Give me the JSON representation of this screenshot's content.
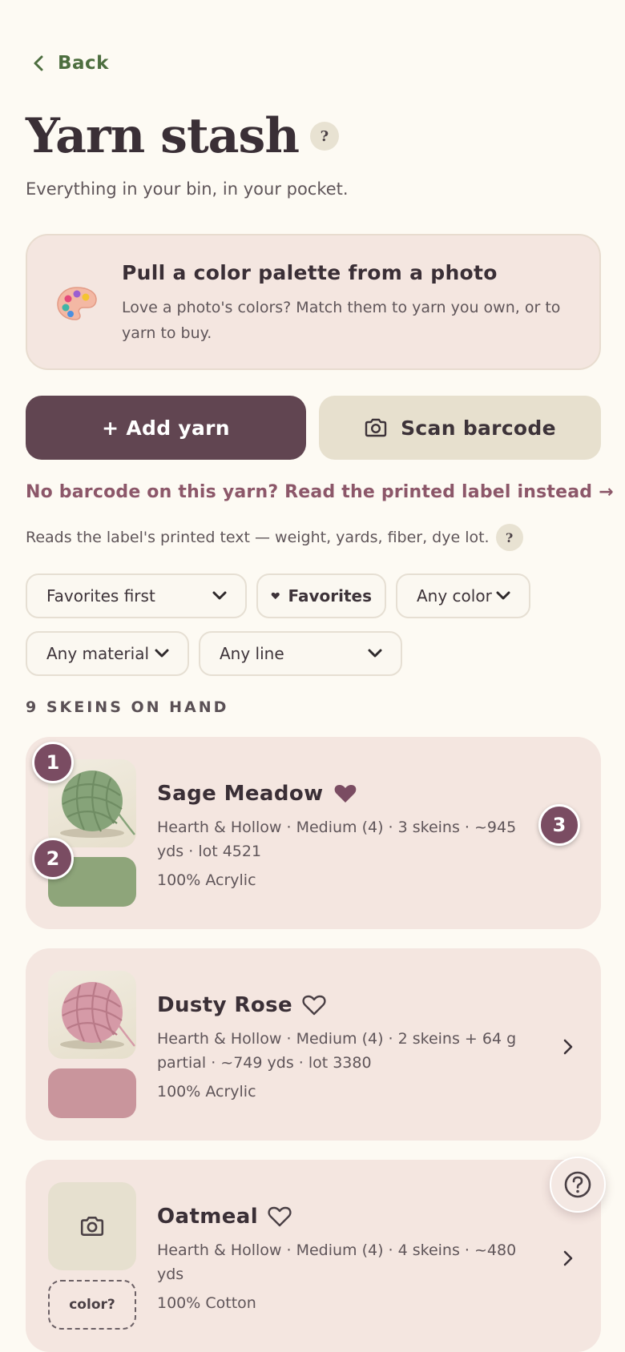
{
  "nav": {
    "back_label": "Back"
  },
  "header": {
    "title": "Yarn stash",
    "help_glyph": "?",
    "subtitle": "Everything in your bin, in your pocket."
  },
  "palette_card": {
    "icon": "palette-icon",
    "title": "Pull a color palette from a photo",
    "description": "Love a photo's colors? Match them to yarn you own, or to yarn to buy."
  },
  "actions": {
    "add_label": "+ Add yarn",
    "scan_label": "Scan barcode",
    "scan_icon": "camera-icon",
    "label_link": "No barcode on this yarn? Read the printed label instead →",
    "label_note": "Reads the label's printed text — weight, yards, fiber, dye lot.",
    "label_help_glyph": "?"
  },
  "filters": {
    "sort": "Favorites first",
    "favorites": "Favorites",
    "color": "Any color",
    "material": "Any material",
    "line": "Any line"
  },
  "stash": {
    "count_label": "9 SKEINS ON HAND",
    "items": [
      {
        "name": "Sage Meadow",
        "favorite": true,
        "meta": "Hearth & Hollow · Medium (4) · 3 skeins · ~945 yds · lot 4521",
        "fiber": "100% Acrylic",
        "swatch_color": "#8ea57a",
        "ball_color": "#86a379"
      },
      {
        "name": "Dusty Rose",
        "favorite": false,
        "meta": "Hearth & Hollow · Medium (4) · 2 skeins + 64 g partial · ~749 yds · lot 3380",
        "fiber": "100% Acrylic",
        "swatch_color": "#c9959c",
        "ball_color": "#d59aa7"
      },
      {
        "name": "Oatmeal",
        "favorite": false,
        "meta": "Hearth & Hollow · Medium (4) · 4 skeins · ~480 yds",
        "fiber": "100% Cotton",
        "swatch_label": "color?",
        "photo_icon": "camera-icon"
      }
    ]
  },
  "markers": [
    "1",
    "2",
    "3"
  ],
  "colors": {
    "accent": "#614551",
    "link": "#8c5769",
    "back": "#4d6e3f",
    "card_bg": "#f4e6e0",
    "page_bg": "#fdfaf3"
  }
}
